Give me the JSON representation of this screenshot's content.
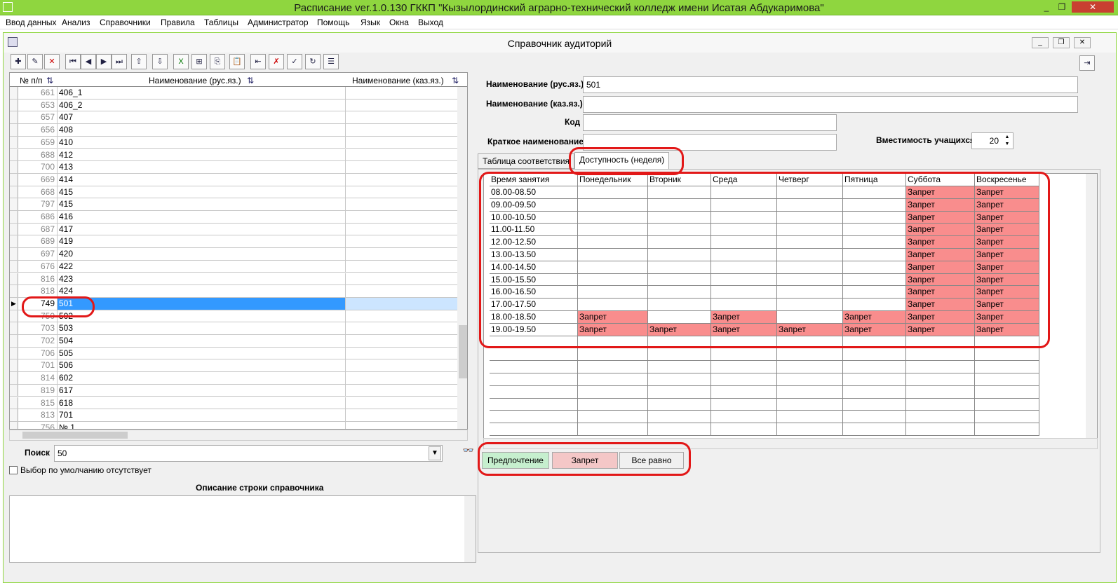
{
  "window": {
    "title": "Расписание ver.1.0.130 ГККП \"Кызылординский аграрно-технический колледж имени Исатая Абдукаримова\""
  },
  "menu": [
    "Ввод данных",
    "Анализ",
    "Справочники",
    "Правила",
    "Таблицы",
    "Администратор",
    "Помощь",
    "Язык",
    "Окна",
    "Выход"
  ],
  "child": {
    "title": "Справочник аудиторий"
  },
  "left_grid": {
    "headers": {
      "num": "№ п/п",
      "ru": "Наименование (рус.яз.)",
      "kz": "Наименование (каз.яз.)"
    },
    "rows": [
      {
        "num": "661",
        "name": "406_1"
      },
      {
        "num": "653",
        "name": "406_2"
      },
      {
        "num": "657",
        "name": "407"
      },
      {
        "num": "656",
        "name": "408"
      },
      {
        "num": "659",
        "name": "410"
      },
      {
        "num": "688",
        "name": "412"
      },
      {
        "num": "700",
        "name": "413"
      },
      {
        "num": "669",
        "name": "414"
      },
      {
        "num": "668",
        "name": "415"
      },
      {
        "num": "797",
        "name": "415"
      },
      {
        "num": "686",
        "name": "416"
      },
      {
        "num": "687",
        "name": "417"
      },
      {
        "num": "689",
        "name": "419"
      },
      {
        "num": "697",
        "name": "420"
      },
      {
        "num": "676",
        "name": "422"
      },
      {
        "num": "816",
        "name": "423"
      },
      {
        "num": "818",
        "name": "424"
      },
      {
        "num": "749",
        "name": "501"
      },
      {
        "num": "750",
        "name": "502"
      },
      {
        "num": "703",
        "name": "503"
      },
      {
        "num": "702",
        "name": "504"
      },
      {
        "num": "706",
        "name": "505"
      },
      {
        "num": "701",
        "name": "506"
      },
      {
        "num": "814",
        "name": "602"
      },
      {
        "num": "819",
        "name": "617"
      },
      {
        "num": "815",
        "name": "618"
      },
      {
        "num": "813",
        "name": "701"
      },
      {
        "num": "756",
        "name": "№ 1"
      }
    ],
    "selected_index": 17
  },
  "search": {
    "label": "Поиск",
    "value": "50"
  },
  "default_choice": {
    "label": "Выбор по умолчанию отсутствует"
  },
  "memo": {
    "label": "Описание строки справочника"
  },
  "form": {
    "name_ru_label": "Наименование (рус.яз.)",
    "name_ru_value": "501",
    "name_kz_label": "Наименование (каз.яз.)",
    "name_kz_value": "",
    "code_label": "Код",
    "code_value": "",
    "short_label": "Краткое наименование",
    "short_value": "",
    "capacity_label": "Вместимость учащихся",
    "capacity_value": "20"
  },
  "tabs": [
    {
      "label": "Таблица соответствия"
    },
    {
      "label": "Доступность (неделя)"
    }
  ],
  "availability": {
    "columns": [
      "Время занятия",
      "Понедельник",
      "Вторник",
      "Среда",
      "Четверг",
      "Пятница",
      "Суббота",
      "Воскресенье"
    ],
    "rows": [
      {
        "time": "08.00-08.50",
        "cells": [
          "",
          "",
          "",
          "",
          "",
          "Запрет",
          "Запрет"
        ]
      },
      {
        "time": "09.00-09.50",
        "cells": [
          "",
          "",
          "",
          "",
          "",
          "Запрет",
          "Запрет"
        ]
      },
      {
        "time": "10.00-10.50",
        "cells": [
          "",
          "",
          "",
          "",
          "",
          "Запрет",
          "Запрет"
        ]
      },
      {
        "time": "11.00-11.50",
        "cells": [
          "",
          "",
          "",
          "",
          "",
          "Запрет",
          "Запрет"
        ]
      },
      {
        "time": "12.00-12.50",
        "cells": [
          "",
          "",
          "",
          "",
          "",
          "Запрет",
          "Запрет"
        ]
      },
      {
        "time": "13.00-13.50",
        "cells": [
          "",
          "",
          "",
          "",
          "",
          "Запрет",
          "Запрет"
        ]
      },
      {
        "time": "14.00-14.50",
        "cells": [
          "",
          "",
          "",
          "",
          "",
          "Запрет",
          "Запрет"
        ]
      },
      {
        "time": "15.00-15.50",
        "cells": [
          "",
          "",
          "",
          "",
          "",
          "Запрет",
          "Запрет"
        ]
      },
      {
        "time": "16.00-16.50",
        "cells": [
          "",
          "",
          "",
          "",
          "",
          "Запрет",
          "Запрет"
        ]
      },
      {
        "time": "17.00-17.50",
        "cells": [
          "",
          "",
          "",
          "",
          "",
          "Запрет",
          "Запрет"
        ]
      },
      {
        "time": "18.00-18.50",
        "cells": [
          "Запрет",
          "",
          "Запрет",
          "",
          "Запрет",
          "Запрет",
          "Запрет"
        ]
      },
      {
        "time": "19.00-19.50",
        "cells": [
          "Запрет",
          "Запрет",
          "Запрет",
          "Запрет",
          "Запрет",
          "Запрет",
          "Запрет"
        ]
      }
    ]
  },
  "legend": {
    "pref": "Предпочтение",
    "deny": "Запрет",
    "any": "Все равно"
  },
  "colors": {
    "titlebar": "#8fd63f",
    "selected": "#3399ff",
    "deny": "#f98d8d",
    "pref": "#c6efce",
    "annotation": "#e21818"
  }
}
